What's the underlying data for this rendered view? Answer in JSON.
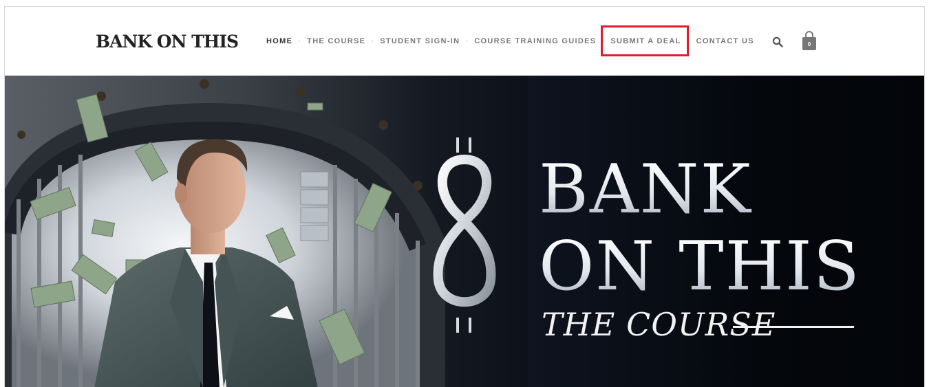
{
  "header": {
    "logo": "BANK ON THIS",
    "nav": [
      {
        "label": "HOME",
        "name": "nav-home"
      },
      {
        "label": "THE COURSE",
        "name": "nav-the-course"
      },
      {
        "label": "STUDENT SIGN-IN",
        "name": "nav-student-sign-in"
      },
      {
        "label": "COURSE TRAINING GUIDES",
        "name": "nav-course-training-guides"
      },
      {
        "label": "SUBMIT A DEAL",
        "name": "nav-submit-a-deal"
      },
      {
        "label": "CONTACT US",
        "name": "nav-contact-us"
      }
    ],
    "separator": "·",
    "search_icon": "search-icon",
    "cart_icon": "shopping-bag-icon",
    "cart_count": "0"
  },
  "hero": {
    "line1": "BANK",
    "line2": "ON THIS",
    "line3": "THE COURSE"
  },
  "colors": {
    "highlight": "#e21c2a",
    "hero_background": "#070b12",
    "nav_text": "#777777"
  }
}
